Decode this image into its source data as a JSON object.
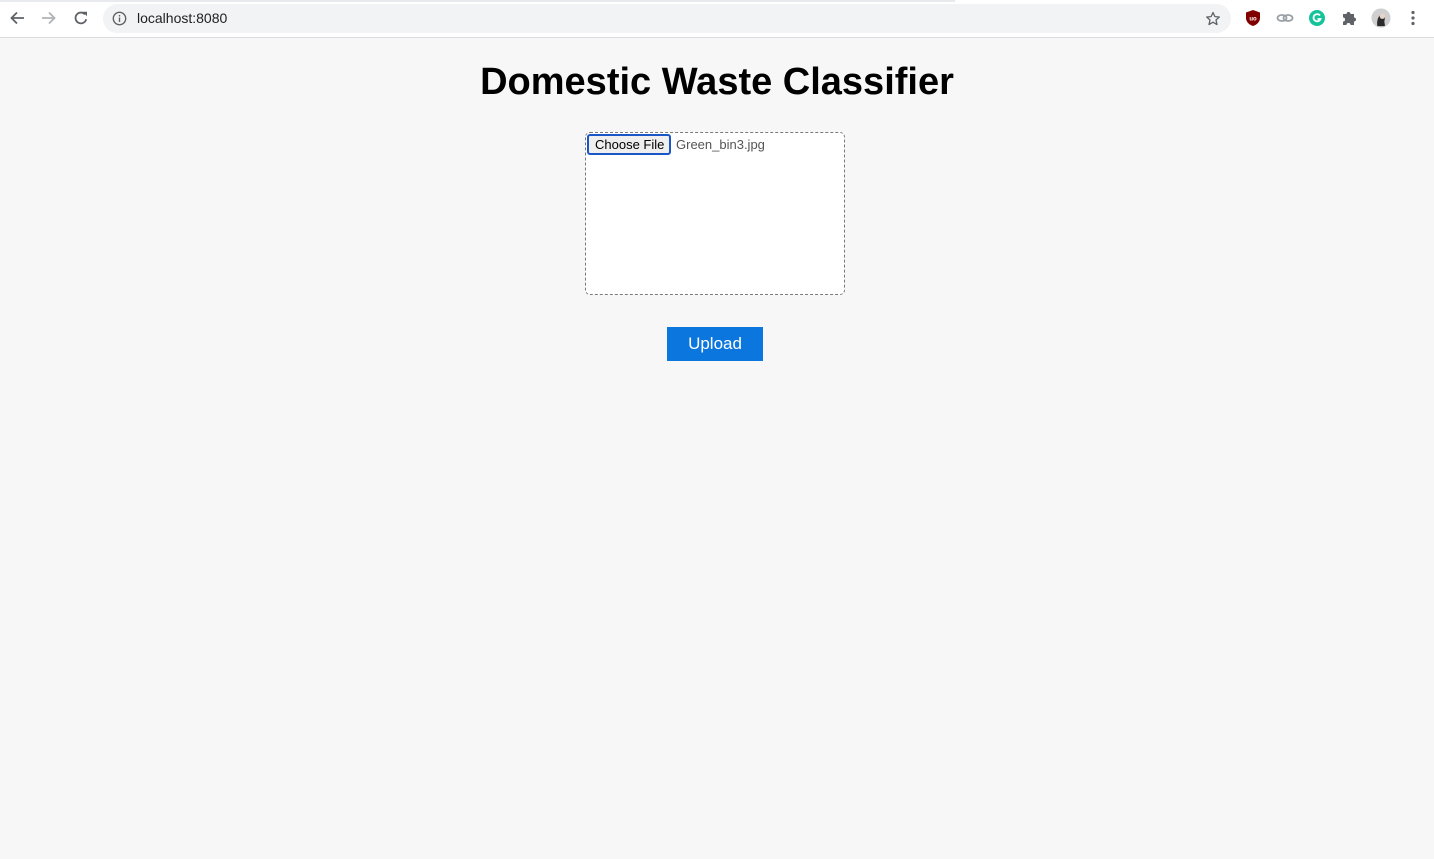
{
  "browser": {
    "url": "localhost:8080",
    "back_icon": "back-arrow-icon",
    "forward_icon": "forward-arrow-icon",
    "reload_icon": "reload-icon",
    "info_icon": "info-icon",
    "bookmark_icon": "star-icon",
    "extensions": [
      "ublock-icon",
      "link-extension-icon",
      "grammarly-icon",
      "puzzle-extensions-icon",
      "profile-avatar-icon",
      "kebab-menu-icon"
    ]
  },
  "page": {
    "title": "Domestic Waste Classifier",
    "file_input": {
      "button_label": "Choose File",
      "selected_file": "Green_bin3.jpg"
    },
    "upload_label": "Upload"
  },
  "colors": {
    "page_background": "#f7f7f7",
    "upload_button": "#0c76df",
    "focus_ring": "#1a56c8"
  }
}
